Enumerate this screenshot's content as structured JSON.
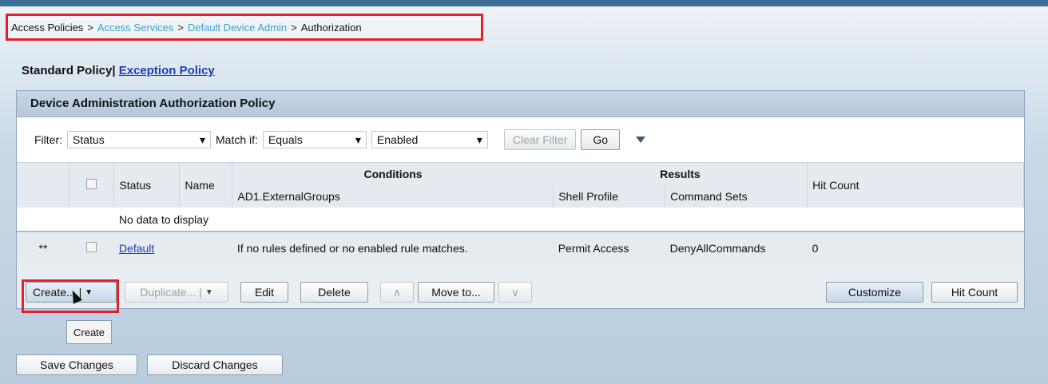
{
  "breadcrumb": {
    "items": [
      "Access Policies",
      "Access Services",
      "Default Device Admin",
      "Authorization"
    ],
    "separator": ">"
  },
  "policy_tabs": {
    "standard": "Standard Policy|",
    "exception": "Exception Policy"
  },
  "panel": {
    "title": "Device Administration Authorization Policy"
  },
  "filter": {
    "label": "Filter:",
    "field": "Status",
    "match_label": "Match if:",
    "operator": "Equals",
    "value": "Enabled",
    "clear_button": "Clear Filter",
    "go_button": "Go"
  },
  "table": {
    "headers": {
      "status": "Status",
      "name": "Name",
      "conditions": "Conditions",
      "conditions_sub": "AD1.ExternalGroups",
      "results": "Results",
      "shell_profile": "Shell Profile",
      "command_sets": "Command Sets",
      "hit_count": "Hit Count"
    },
    "no_data": "No data to display",
    "default_row": {
      "marker": "**",
      "name": "Default",
      "condition": "If no rules defined or no enabled rule matches.",
      "shell_profile": "Permit Access",
      "command_sets": "DenyAllCommands",
      "hit_count": "0"
    }
  },
  "toolbar": {
    "create": "Create... |",
    "duplicate": "Duplicate... |",
    "edit": "Edit",
    "delete": "Delete",
    "move_up": "∧",
    "move_to": "Move to...",
    "move_down": "∨",
    "customize": "Customize",
    "hit_count": "Hit Count"
  },
  "tooltip": "Create",
  "bottom": {
    "save": "Save Changes",
    "discard": "Discard Changes"
  },
  "colors": {
    "highlight_border": "#e0212b",
    "link": "#1a3fb5",
    "breadcrumb_link": "#3aa2c8"
  }
}
